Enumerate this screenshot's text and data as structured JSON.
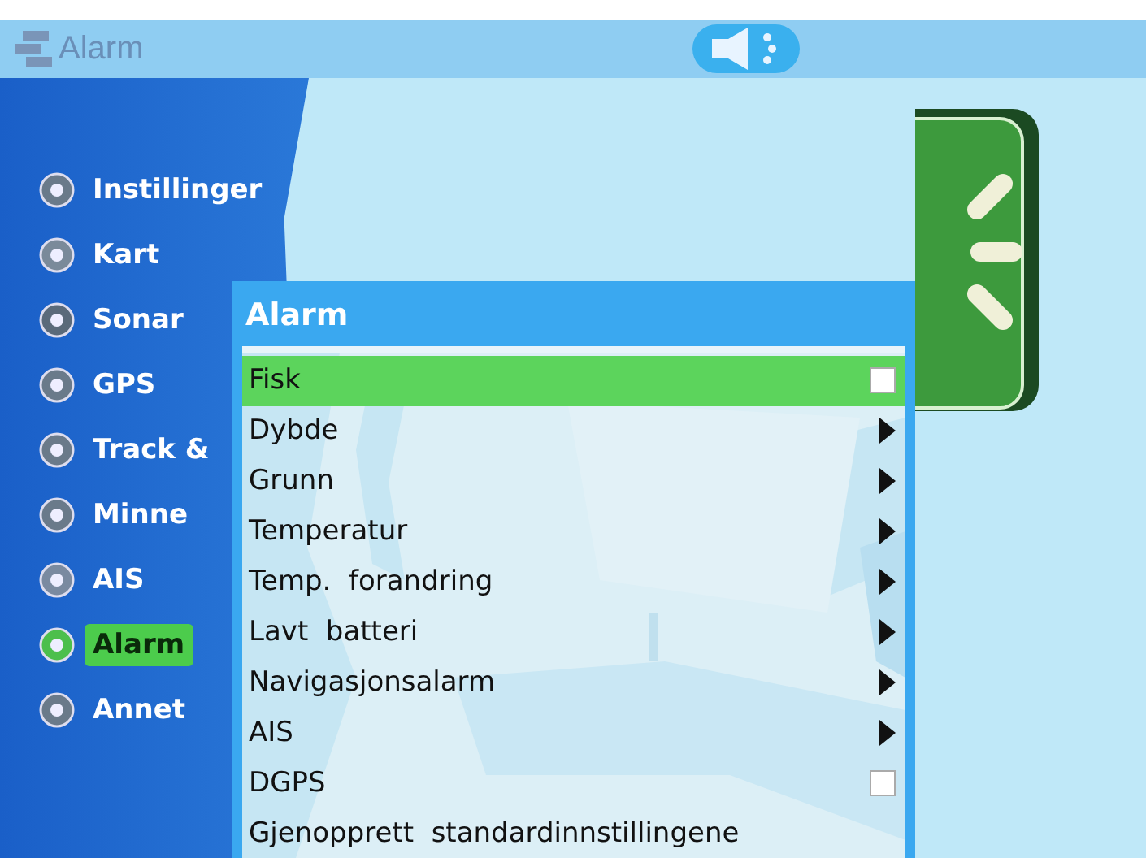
{
  "title_bar": {
    "title": "Alarm"
  },
  "sidebar": {
    "items": [
      {
        "label": "Instillinger",
        "selected": false
      },
      {
        "label": "Kart",
        "selected": false
      },
      {
        "label": "Sonar",
        "selected": false
      },
      {
        "label": "GPS",
        "selected": false
      },
      {
        "label": "Track &",
        "selected": false
      },
      {
        "label": "Minne",
        "selected": false
      },
      {
        "label": "AIS",
        "selected": false
      },
      {
        "label": "Alarm",
        "selected": true
      },
      {
        "label": "Annet",
        "selected": false
      }
    ]
  },
  "menu": {
    "title": "Alarm",
    "items": [
      {
        "label": "Fisk",
        "kind": "checkbox",
        "checked": false,
        "selected": true
      },
      {
        "label": "Dybde",
        "kind": "submenu",
        "selected": false
      },
      {
        "label": "Grunn",
        "kind": "submenu",
        "selected": false
      },
      {
        "label": "Temperatur",
        "kind": "submenu",
        "selected": false
      },
      {
        "label": "Temp.  forandring",
        "kind": "submenu",
        "selected": false
      },
      {
        "label": "Lavt  batteri",
        "kind": "submenu",
        "selected": false
      },
      {
        "label": "Navigasjonsalarm",
        "kind": "submenu",
        "selected": false
      },
      {
        "label": "AIS",
        "kind": "submenu",
        "selected": false
      },
      {
        "label": "DGPS",
        "kind": "checkbox",
        "checked": false,
        "selected": false
      },
      {
        "label": "Gjenopprett  standardinnstillingene",
        "kind": "action",
        "selected": false
      }
    ]
  }
}
